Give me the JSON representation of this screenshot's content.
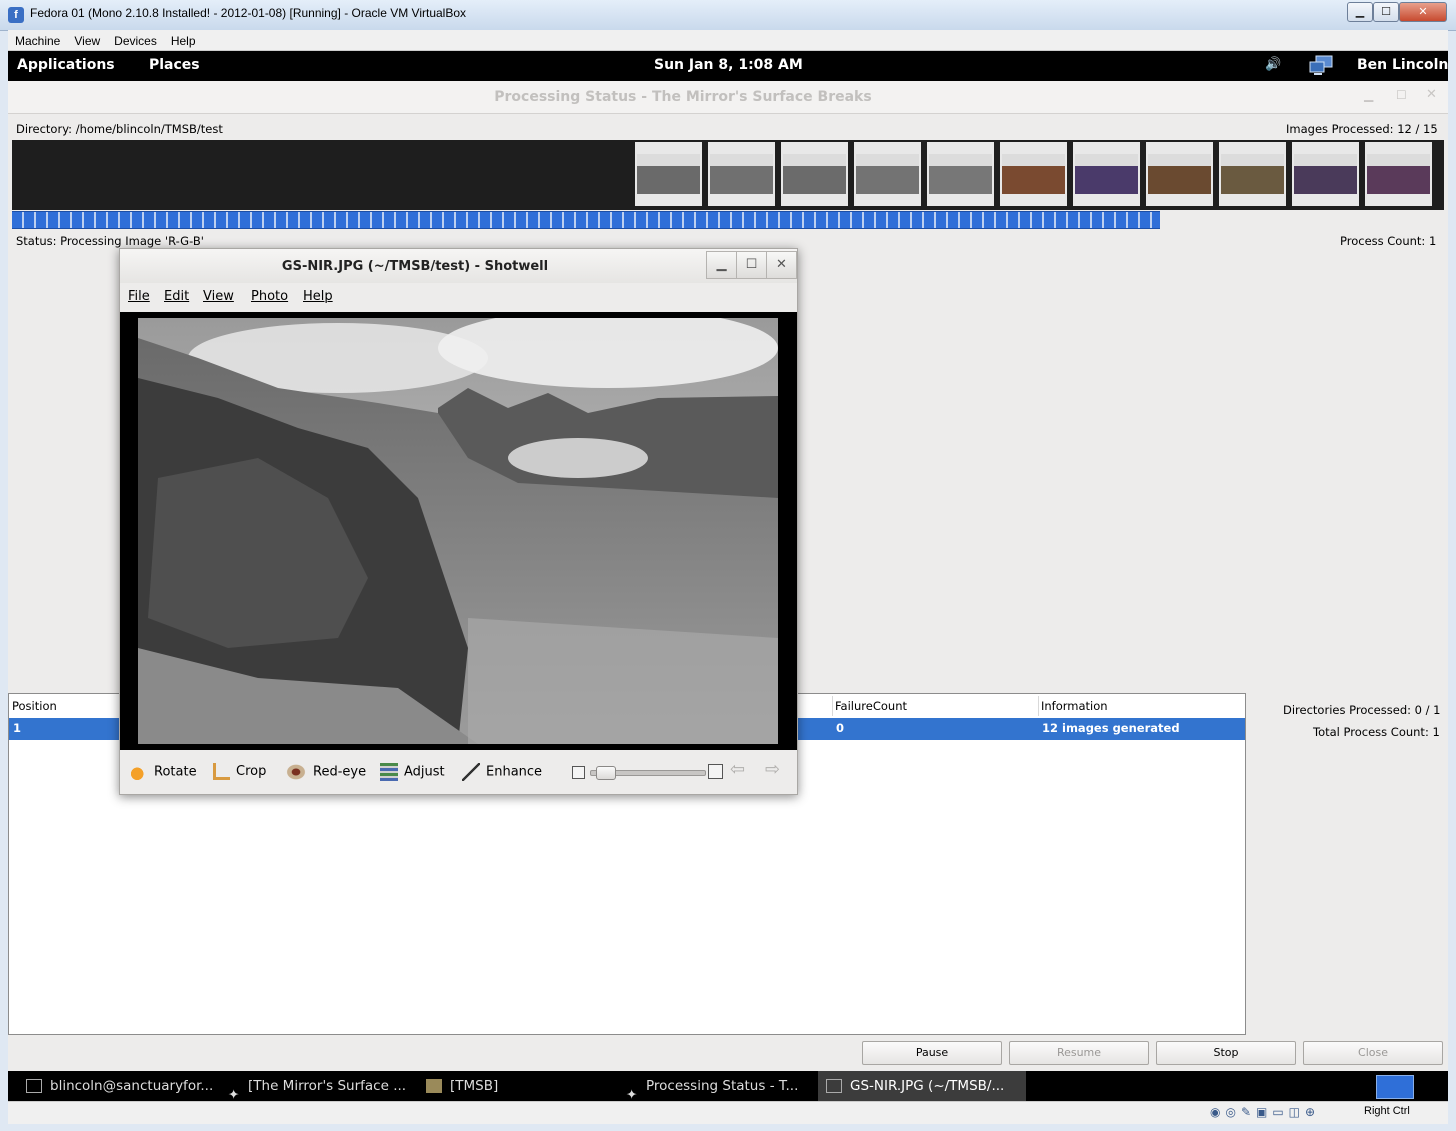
{
  "vbox": {
    "title": "Fedora 01 (Mono 2.10.8 Installed! - 2012-01-08) [Running] - Oracle VM VirtualBox",
    "icon_letter": "f",
    "min_glyph": "▁",
    "max_glyph": "☐",
    "close_glyph": "✕",
    "menu": [
      "Machine",
      "View",
      "Devices",
      "Help"
    ],
    "host_key_label": "Right Ctrl"
  },
  "gnome": {
    "applications": "Applications",
    "places": "Places",
    "clock": "Sun Jan  8,  1:08 AM",
    "user": "Ben Lincoln",
    "volume_glyph": "🔊"
  },
  "processing": {
    "title": "Processing Status - The Mirror's Surface Breaks",
    "directory": "Directory: /home/blincoln/TMSB/test",
    "images_processed": "Images Processed: 12 / 15",
    "progress_fraction": 0.8,
    "status": "Status: Processing Image 'R-G-B'",
    "process_count": "Process Count: 1",
    "directories_processed": "Directories Processed: 0 / 1",
    "total_process_count": "Total Process Count: 1",
    "columns": [
      "Position",
      "FailureCount",
      "Information"
    ],
    "rows": [
      {
        "position": "1",
        "failure_count": "0",
        "information": "12 images generated"
      }
    ],
    "buttons": {
      "pause": "Pause",
      "resume": "Resume",
      "stop": "Stop",
      "close": "Close"
    },
    "thumb_colors": [
      "#6a6a6a",
      "#707070",
      "#6b6b6b",
      "#737373",
      "#777777",
      "#7a4a30",
      "#4a3a6a",
      "#6a4a30",
      "#6a5a40",
      "#4a3a5a",
      "#5a3a5a"
    ]
  },
  "shotwell": {
    "title": "GS-NIR.JPG (~/TMSB/test) - Shotwell",
    "min_glyph": "▁",
    "max_glyph": "☐",
    "close_glyph": "✕",
    "menu": [
      "File",
      "Edit",
      "View",
      "Photo",
      "Help"
    ],
    "tools": [
      "Rotate",
      "Crop",
      "Red-eye",
      "Adjust",
      "Enhance"
    ],
    "zoom_fraction": 0.05,
    "prev_glyph": "⇦",
    "next_glyph": "⇨"
  },
  "taskbar": [
    {
      "label": "blincoln@sanctuaryfor...",
      "active": false
    },
    {
      "label": "[The Mirror's Surface ...",
      "active": false
    },
    {
      "label": "[TMSB]",
      "active": false
    },
    {
      "label": "Processing Status - T...",
      "active": false
    },
    {
      "label": "GS-NIR.JPG (~/TMSB/...",
      "active": true
    }
  ]
}
